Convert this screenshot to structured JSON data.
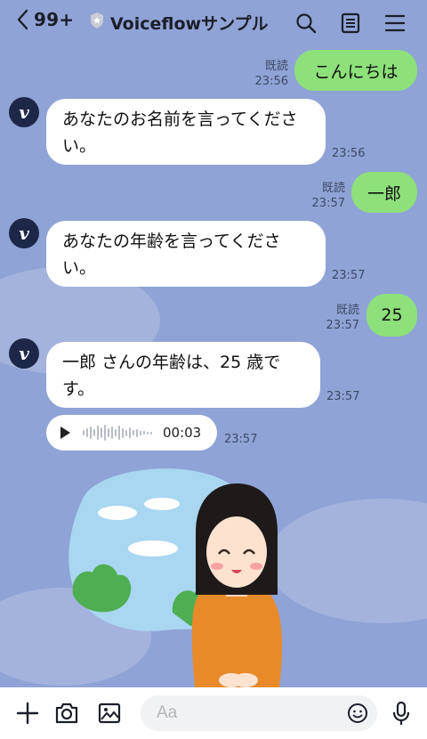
{
  "header": {
    "back_count": "99+",
    "title": "Voiceflowサンプル",
    "icons": [
      "chevron-left-icon",
      "verified-badge-icon",
      "search-icon",
      "notes-icon",
      "menu-icon"
    ]
  },
  "messages": [
    {
      "direction": "out",
      "text": "こんにちは",
      "read": "既読",
      "time": "23:56"
    },
    {
      "direction": "in",
      "avatar": "v",
      "text": "あなたのお名前を言ってください。",
      "time": "23:56"
    },
    {
      "direction": "out",
      "text": "一郎",
      "read": "既読",
      "time": "23:57"
    },
    {
      "direction": "in",
      "avatar": "v",
      "text": "あなたの年齢を言ってください。",
      "time": "23:57"
    },
    {
      "direction": "out",
      "text": "25",
      "read": "既読",
      "time": "23:57"
    },
    {
      "direction": "in",
      "avatar": "v",
      "text": "一郎 さんの年齢は、25 歳です。",
      "time": "23:57"
    },
    {
      "direction": "in",
      "type": "voice",
      "duration": "00:03",
      "time": "23:57"
    },
    {
      "direction": "in",
      "type": "sticker",
      "sticker": "bowing-woman-sticker"
    }
  ],
  "composer": {
    "placeholder": "Aa",
    "icons": [
      "plus-icon",
      "camera-icon",
      "image-icon",
      "emoji-icon",
      "microphone-icon"
    ]
  },
  "colors": {
    "background": "#8fa3d6",
    "outgoing_bubble": "#8de07a",
    "incoming_bubble": "#ffffff",
    "avatar": "#1d2747"
  }
}
